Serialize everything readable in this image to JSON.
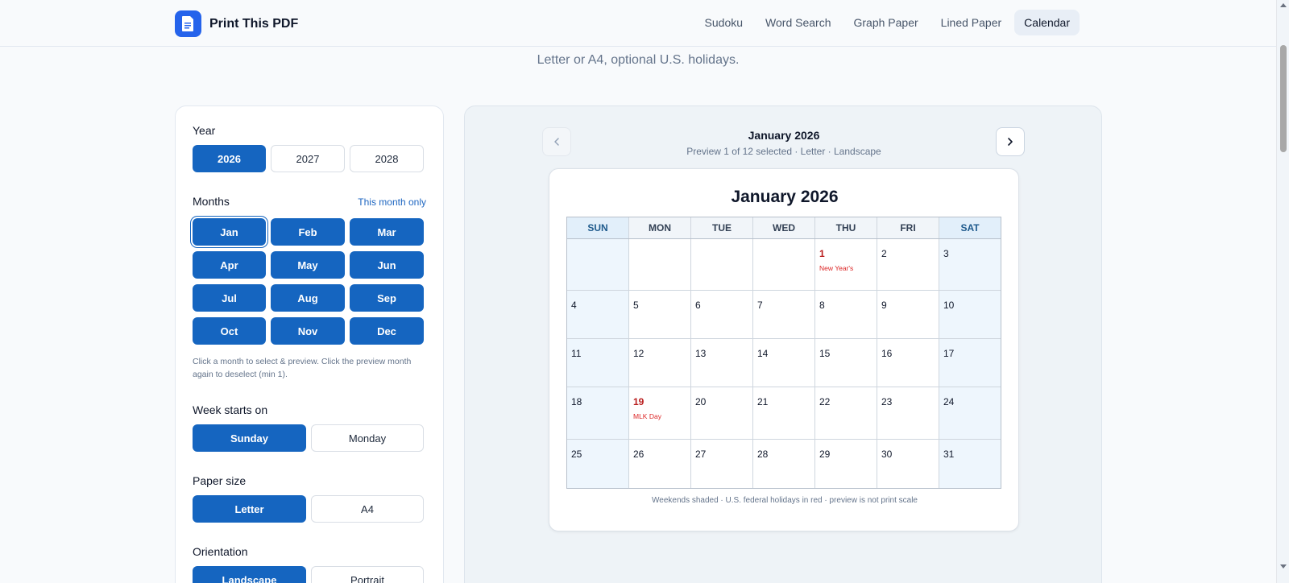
{
  "brand": {
    "name": "Print This PDF",
    "logo_icon": "document-icon"
  },
  "nav": [
    {
      "label": "Sudoku",
      "active": false
    },
    {
      "label": "Word Search",
      "active": false
    },
    {
      "label": "Graph Paper",
      "active": false
    },
    {
      "label": "Lined Paper",
      "active": false
    },
    {
      "label": "Calendar",
      "active": true
    }
  ],
  "subtitle": "Letter or A4, optional U.S. holidays.",
  "settings": {
    "year": {
      "label": "Year",
      "options": [
        {
          "label": "2026",
          "selected": true
        },
        {
          "label": "2027",
          "selected": false
        },
        {
          "label": "2028",
          "selected": false
        }
      ]
    },
    "months": {
      "label": "Months",
      "shortcut": "This month only",
      "options": [
        {
          "label": "Jan",
          "selected": true,
          "focused": true
        },
        {
          "label": "Feb",
          "selected": true
        },
        {
          "label": "Mar",
          "selected": true
        },
        {
          "label": "Apr",
          "selected": true
        },
        {
          "label": "May",
          "selected": true
        },
        {
          "label": "Jun",
          "selected": true
        },
        {
          "label": "Jul",
          "selected": true
        },
        {
          "label": "Aug",
          "selected": true
        },
        {
          "label": "Sep",
          "selected": true
        },
        {
          "label": "Oct",
          "selected": true
        },
        {
          "label": "Nov",
          "selected": true
        },
        {
          "label": "Dec",
          "selected": true
        }
      ],
      "help": "Click a month to select & preview. Click the preview month again to deselect (min 1)."
    },
    "week_start": {
      "label": "Week starts on",
      "options": [
        {
          "label": "Sunday",
          "selected": true
        },
        {
          "label": "Monday",
          "selected": false
        }
      ]
    },
    "paper": {
      "label": "Paper size",
      "options": [
        {
          "label": "Letter",
          "selected": true
        },
        {
          "label": "A4",
          "selected": false
        }
      ]
    },
    "orientation": {
      "label": "Orientation",
      "options": [
        {
          "label": "Landscape",
          "selected": true
        },
        {
          "label": "Portrait",
          "selected": false
        }
      ]
    }
  },
  "preview": {
    "title": "January 2026",
    "subtitle": "Preview 1 of 12 selected · Letter · Landscape",
    "prev_icon": "chevron-left-icon",
    "next_icon": "chevron-right-icon",
    "calendar": {
      "title": "January 2026",
      "weekdays": [
        "SUN",
        "MON",
        "TUE",
        "WED",
        "THU",
        "FRI",
        "SAT"
      ],
      "weeks": [
        [
          null,
          null,
          null,
          null,
          {
            "d": "1",
            "holiday": "New Year's"
          },
          {
            "d": "2"
          },
          {
            "d": "3"
          }
        ],
        [
          {
            "d": "4"
          },
          {
            "d": "5"
          },
          {
            "d": "6"
          },
          {
            "d": "7"
          },
          {
            "d": "8"
          },
          {
            "d": "9"
          },
          {
            "d": "10"
          }
        ],
        [
          {
            "d": "11"
          },
          {
            "d": "12"
          },
          {
            "d": "13"
          },
          {
            "d": "14"
          },
          {
            "d": "15"
          },
          {
            "d": "16"
          },
          {
            "d": "17"
          }
        ],
        [
          {
            "d": "18"
          },
          {
            "d": "19",
            "holiday": "MLK Day"
          },
          {
            "d": "20"
          },
          {
            "d": "21"
          },
          {
            "d": "22"
          },
          {
            "d": "23"
          },
          {
            "d": "24"
          }
        ],
        [
          {
            "d": "25"
          },
          {
            "d": "26"
          },
          {
            "d": "27"
          },
          {
            "d": "28"
          },
          {
            "d": "29"
          },
          {
            "d": "30"
          },
          {
            "d": "31"
          }
        ]
      ],
      "footer": "Weekends shaded · U.S. federal holidays in red · preview is not print scale"
    }
  },
  "colors": {
    "accent": "#1565c0",
    "holiday": "#dc2626",
    "weekend": "#eef6fd"
  }
}
